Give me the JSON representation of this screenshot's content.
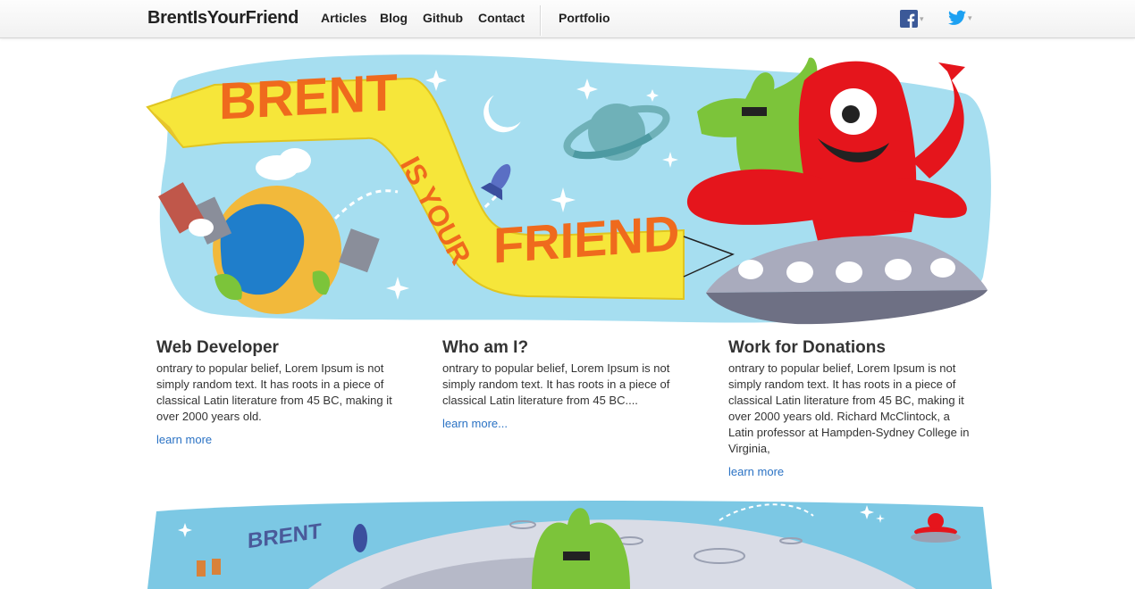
{
  "nav": {
    "brand": "BrentIsYourFriend",
    "links": [
      "Articles",
      "Blog",
      "Github",
      "Contact",
      "Portfolio"
    ],
    "social": [
      "facebook-icon",
      "twitter-icon"
    ]
  },
  "hero": {
    "banner_lines": [
      "BRENT",
      "IS YOUR",
      "FRIEND"
    ]
  },
  "columns": [
    {
      "title": "Web Developer",
      "text": "ontrary to popular belief, Lorem Ipsum is not simply random text. It has roots in a piece of classical Latin literature from 45 BC, making it over 2000 years old.",
      "link": "learn more"
    },
    {
      "title": "Who am I?",
      "text": "ontrary to popular belief, Lorem Ipsum is not simply random text. It has roots in a piece of classical Latin literature from 45 BC....",
      "link": "learn more..."
    },
    {
      "title": "Work for Donations",
      "text": "ontrary to popular belief, Lorem Ipsum is not simply random text. It has roots in a piece of classical Latin literature from 45 BC, making it over 2000 years old. Richard McClintock, a Latin professor at Hampden-Sydney College in Virginia,",
      "link": "learn more"
    }
  ],
  "footer_art": {
    "sign_text": "BRENT"
  },
  "colors": {
    "sky": "#a6def0",
    "banner": "#f6e63a",
    "banner_text": "#ef6a1d",
    "monster_red": "#e5151c",
    "alien_green": "#7cc43a",
    "link": "#2a72c4"
  }
}
